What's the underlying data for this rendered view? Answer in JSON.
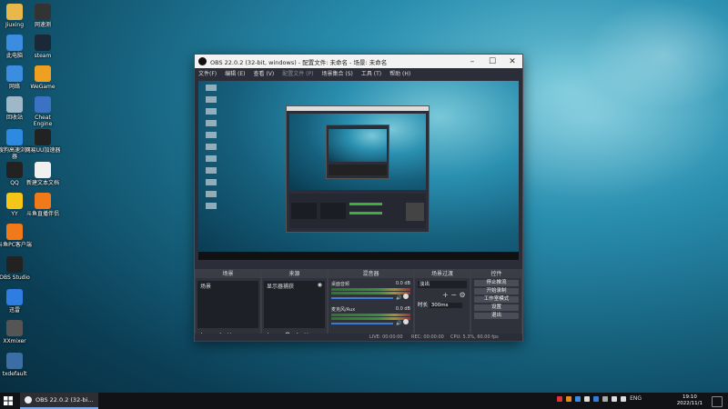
{
  "desktop": {
    "icons_left": [
      {
        "label": "Jiuxing",
        "icon": "user-folder-icon",
        "color": "#e8b84a"
      },
      {
        "label": "此电脑",
        "icon": "computer-icon",
        "color": "#3c8de0"
      },
      {
        "label": "网络",
        "icon": "network-icon",
        "color": "#3c8de0"
      },
      {
        "label": "回收站",
        "icon": "recycle-bin-icon",
        "color": "#9fb8c8"
      },
      {
        "label": "搜狗高速浏览器",
        "icon": "sogou-browser-icon",
        "color": "#2d8ae0"
      },
      {
        "label": "QQ",
        "icon": "qq-icon",
        "color": "#222"
      },
      {
        "label": "YY",
        "icon": "yy-icon",
        "color": "#f5c518"
      },
      {
        "label": "斗鱼PC客户端",
        "icon": "douyu-icon",
        "color": "#f07a1a"
      },
      {
        "label": "OBS Studio",
        "icon": "obs-icon",
        "color": "#222"
      },
      {
        "label": "迅雷",
        "icon": "xunlei-icon",
        "color": "#2f7de0"
      },
      {
        "label": "XXmixer",
        "icon": "mixer-icon",
        "color": "#555"
      },
      {
        "label": "txdefault",
        "icon": "app-icon",
        "color": "#3a6ea5"
      }
    ],
    "icons_right": [
      {
        "label": "网速测",
        "icon": "speedtest-icon",
        "color": "#333"
      },
      {
        "label": "steam",
        "icon": "steam-icon",
        "color": "#1b2838"
      },
      {
        "label": "WeGame",
        "icon": "wegame-icon",
        "color": "#f0a020"
      },
      {
        "label": "Cheat Engine",
        "icon": "cheat-engine-icon",
        "color": "#3c72c4"
      },
      {
        "label": "网易UU加速器",
        "icon": "uu-accelerator-icon",
        "color": "#222"
      },
      {
        "label": "新建文本文档",
        "icon": "text-document-icon",
        "color": "#f0f0f0"
      },
      {
        "label": "斗鱼直播伴侣",
        "icon": "douyu-live-icon",
        "color": "#f07a1a"
      }
    ]
  },
  "obs_window": {
    "title": "OBS 22.0.2 (32-bit, windows) - 配置文件: 未命名 - 场景: 未命名",
    "menu": [
      "文件(F)",
      "编辑 (E)",
      "查看 (V)",
      "配置文件 (P)",
      "场景集合 (S)",
      "工具 (T)",
      "帮助 (H)"
    ],
    "docks": {
      "scenes": {
        "title": "场景",
        "items": [
          "场景"
        ]
      },
      "sources": {
        "title": "来源",
        "items": [
          "显示器捕获"
        ]
      },
      "mixer": {
        "title": "混音器",
        "channels": [
          {
            "name": "桌面音频",
            "level": "0.0 dB"
          },
          {
            "name": "麦克风/Aux",
            "level": "0.0 dB"
          }
        ]
      },
      "transitions": {
        "title": "场景过渡",
        "type": "淡出",
        "duration_label": "时长",
        "duration": "300ms"
      },
      "controls": {
        "title": "控件",
        "buttons": [
          "停止推流",
          "开始录制",
          "工作室模式",
          "设置",
          "退出"
        ]
      }
    },
    "status": {
      "live": "LIVE: 00:00:00",
      "rec": "REC: 00:00:00",
      "cpu": "CPU: 5.3%, 60.00 fps"
    }
  },
  "taskbar": {
    "task_label": "OBS 22.0.2 (32-bi...",
    "lang": "ENG",
    "time": "19:10",
    "date": "2022/11/1"
  }
}
